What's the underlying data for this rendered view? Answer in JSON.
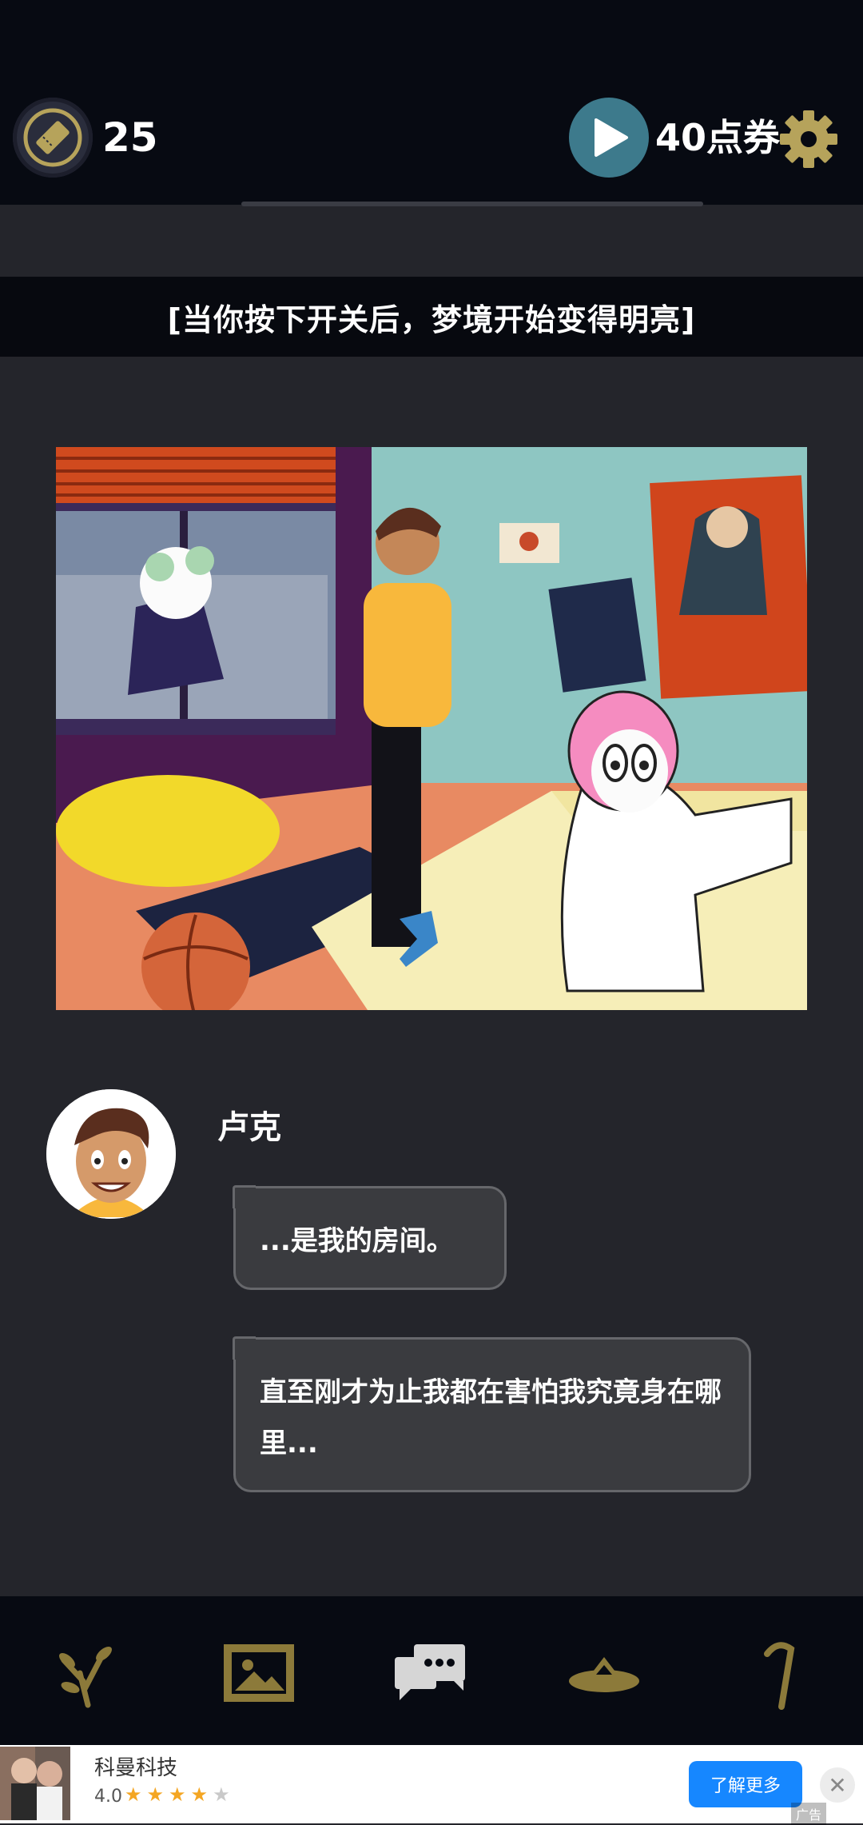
{
  "header": {
    "ticket_count": "25",
    "coupon_label": "40点券"
  },
  "banner": {
    "text": "[当你按下开关后，梦境开始变得明亮]"
  },
  "dialogue": {
    "speaker": "卢克",
    "lines": [
      "...是我的房间。",
      "直至刚才为止我都在害怕我究竟身在哪里..."
    ]
  },
  "bottom_nav": {
    "items": [
      "plant-icon",
      "gallery-icon",
      "chat-icon",
      "hat-icon",
      "cane-icon"
    ]
  },
  "ad": {
    "advertiser": "科曼科技",
    "rating": "4.0",
    "cta_label": "了解更多",
    "tag": "广告"
  },
  "colors": {
    "gold": "#8c7a3a",
    "play_teal": "#3d7a8c",
    "cta_blue": "#1687ff"
  }
}
